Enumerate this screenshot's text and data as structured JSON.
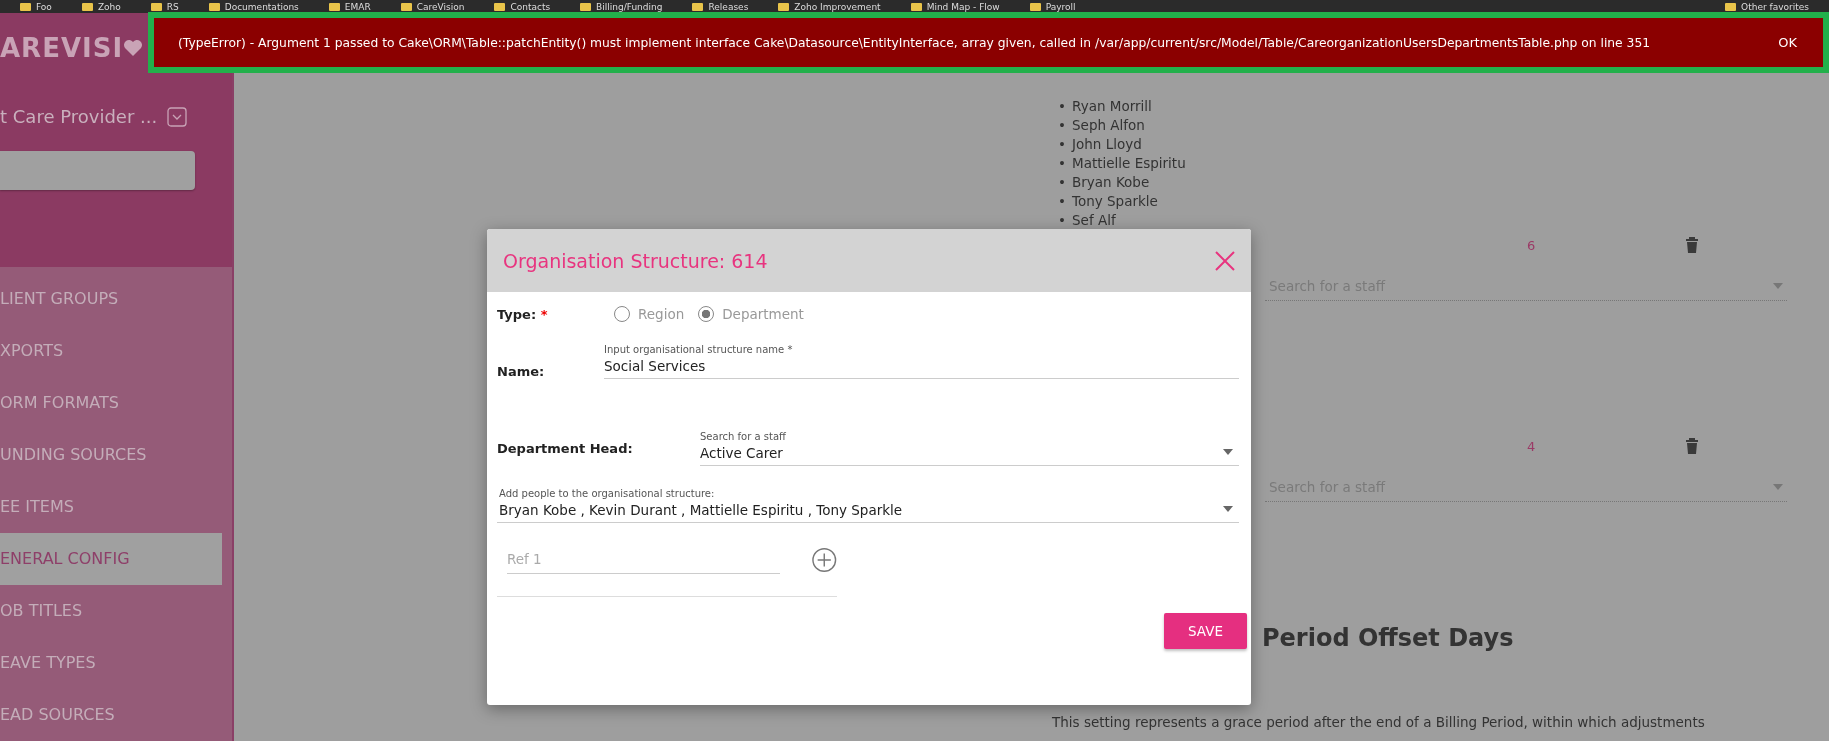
{
  "bookmarks_bar": {
    "items": [
      {
        "label": "Foo"
      },
      {
        "label": "Zoho"
      },
      {
        "label": "RS"
      },
      {
        "label": "Documentations"
      },
      {
        "label": "EMAR"
      },
      {
        "label": "CareVision"
      },
      {
        "label": "Contacts"
      },
      {
        "label": "Billing/Funding"
      },
      {
        "label": "Releases"
      },
      {
        "label": "Zoho Improvement"
      },
      {
        "label": "Mind Map - Flow"
      },
      {
        "label": "Payroll"
      }
    ],
    "other": "Other favorites"
  },
  "sidebar": {
    "logo": "AREVISI",
    "organisation": "t Care Provider ...",
    "menu": [
      {
        "label": "LIENT GROUPS",
        "selected": false
      },
      {
        "label": "XPORTS",
        "selected": false
      },
      {
        "label": "ORM FORMATS",
        "selected": false
      },
      {
        "label": "UNDING SOURCES",
        "selected": false
      },
      {
        "label": "EE ITEMS",
        "selected": false
      },
      {
        "label": "ENERAL CONFIG",
        "selected": true
      },
      {
        "label": "OB TITLES",
        "selected": false
      },
      {
        "label": "EAVE TYPES",
        "selected": false
      },
      {
        "label": "EAD SOURCES",
        "selected": false
      }
    ]
  },
  "error_banner": {
    "message": "(TypeError) - Argument 1 passed to Cake\\ORM\\Table::patchEntity() must implement interface Cake\\Datasource\\EntityInterface, array given, called in /var/app/current/src/Model/Table/CareorganizationUsersDepartmentsTable.php on line 351",
    "action": "OK"
  },
  "background_page": {
    "list_marker": "•",
    "staff_list": [
      "Ryan Morrill",
      "Seph Alfon",
      "John Lloyd",
      "Mattielle Espiritu",
      "Bryan Kobe",
      "Tony Sparkle",
      "Sef Alf"
    ],
    "groups": [
      {
        "count": "6",
        "placeholder": "Search for a staff"
      },
      {
        "count": "4",
        "placeholder": "Search for a staff"
      }
    ],
    "heading": "Period Offset Days",
    "paragraph": "This setting represents a grace period after the end of a Billing Period, within which adjustments"
  },
  "modal": {
    "title": "Organisation Structure: 614",
    "type": {
      "label": "Type:",
      "required_mark": "*",
      "options": [
        {
          "label": "Region",
          "selected": false
        },
        {
          "label": "Department",
          "selected": true
        }
      ]
    },
    "name": {
      "label": "Name:",
      "field_label": "Input organisational structure name *",
      "value": "Social Services"
    },
    "department_head": {
      "label": "Department Head:",
      "field_label": "Search for a staff",
      "value": "Active Carer"
    },
    "people": {
      "field_label": "Add people to the organisational structure:",
      "value": "Bryan Kobe , Kevin Durant , Mattielle Espiritu , Tony Sparkle"
    },
    "ref": {
      "placeholder": "Ref 1"
    },
    "save": "SAVE"
  }
}
